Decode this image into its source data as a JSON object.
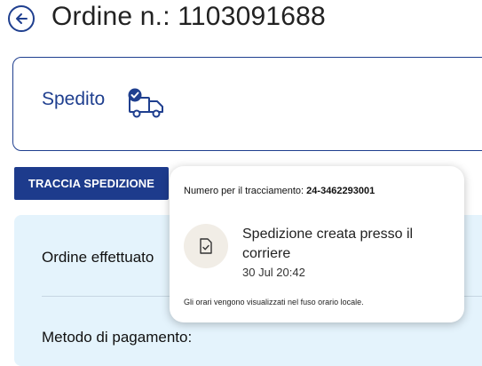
{
  "header": {
    "title": "Ordine n.: 1103091688"
  },
  "status": {
    "label": "Spedito"
  },
  "actions": {
    "track_label": "TRACCIA SPEDIZIONE"
  },
  "details": {
    "order_label": "Ordine effettuato",
    "payment_label": "Metodo di pagamento:"
  },
  "tracking_popover": {
    "number_label": "Numero per il tracciamento:",
    "number_value": "24-3462293001",
    "event_title": "Spedizione creata presso il corriere",
    "event_time": "30 Jul 20:42",
    "timezone_note": "Gli orari vengono visualizzati nel fuso orario locale."
  },
  "colors": {
    "brand_blue": "#1d3b8c",
    "panel_bg": "#e4f3fc",
    "icon_bg": "#f1ede6"
  },
  "icons": {
    "back": "arrow-left-circle-icon",
    "status": "truck-check-icon",
    "event": "document-check-icon"
  }
}
